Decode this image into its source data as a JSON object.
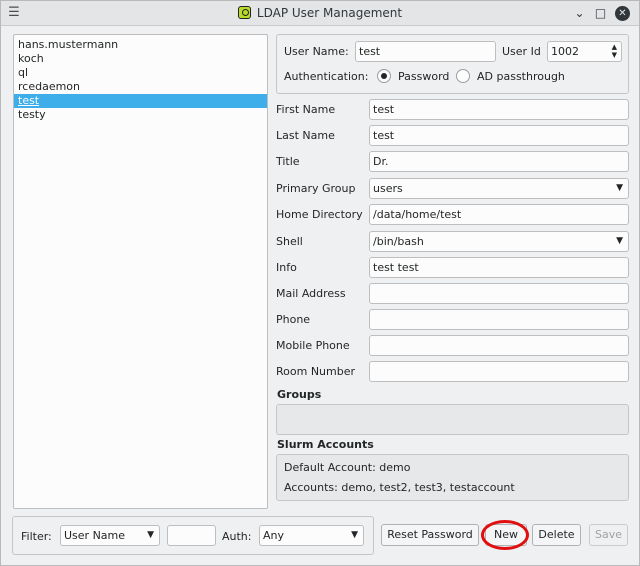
{
  "window": {
    "title": "LDAP User Management",
    "menu_icon": "hamburger-menu-icon",
    "app_icon": "qt-app-icon"
  },
  "users": [
    "hans.mustermann",
    "koch",
    "ql",
    "rcedaemon",
    "test",
    "testy"
  ],
  "selected_user": "test",
  "header": {
    "username_label": "User Name:",
    "username_value": "test",
    "userid_label": "User Id",
    "userid_value": "1002",
    "auth_label": "Authentication:",
    "auth_password": "Password",
    "auth_ad": "AD passthrough",
    "auth_selected": "Password"
  },
  "form": {
    "first_name": {
      "label": "First Name",
      "value": "test"
    },
    "last_name": {
      "label": "Last Name",
      "value": "test"
    },
    "title": {
      "label": "Title",
      "value": "Dr."
    },
    "primary_group": {
      "label": "Primary Group",
      "value": "users"
    },
    "home_directory": {
      "label": "Home Directory",
      "value": "/data/home/test"
    },
    "shell": {
      "label": "Shell",
      "value": "/bin/bash"
    },
    "info": {
      "label": "Info",
      "value": "test test"
    },
    "mail_address": {
      "label": "Mail Address",
      "value": ""
    },
    "phone": {
      "label": "Phone",
      "value": ""
    },
    "mobile_phone": {
      "label": "Mobile Phone",
      "value": ""
    },
    "room_number": {
      "label": "Room Number",
      "value": ""
    }
  },
  "groups": {
    "heading": "Groups"
  },
  "slurm": {
    "heading": "Slurm Accounts",
    "default_account": "Default Account: demo",
    "accounts": "Accounts: demo, test2, test3, testaccount"
  },
  "filter": {
    "label": "Filter:",
    "field_value": "User Name",
    "text_value": "",
    "auth_label": "Auth:",
    "auth_value": "Any"
  },
  "buttons": {
    "reset_password": "Reset Password",
    "new": "New",
    "delete": "Delete",
    "save": "Save"
  },
  "colors": {
    "selection": "#3daee9",
    "highlight_ring": "#e01010"
  }
}
